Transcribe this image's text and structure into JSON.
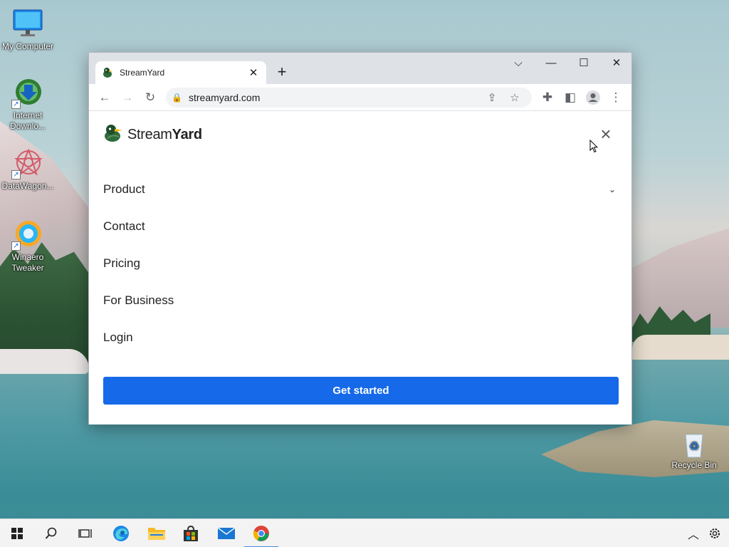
{
  "desktop": {
    "icons": [
      {
        "label": "My Computer",
        "icon": "monitor-icon"
      },
      {
        "label": "Internet Downlo...",
        "icon": "download-manager-icon"
      },
      {
        "label": "DataWagon...",
        "icon": "datawagon-icon"
      },
      {
        "label": "Winaero Tweaker",
        "icon": "winaero-tweaker-icon"
      },
      {
        "label": "Recycle Bin",
        "icon": "recycle-bin-icon"
      }
    ]
  },
  "browser": {
    "tab": {
      "title": "StreamYard",
      "favicon": "streamyard-duck-icon"
    },
    "address": {
      "url": "streamyard.com"
    },
    "window_controls": [
      "chevron-down-icon",
      "minimize-icon",
      "maximize-icon",
      "close-icon"
    ]
  },
  "page": {
    "logo": {
      "word1": "Stream",
      "word2": "Yard"
    },
    "menu": [
      {
        "label": "Product",
        "has_submenu": true
      },
      {
        "label": "Contact"
      },
      {
        "label": "Pricing"
      },
      {
        "label": "For Business"
      },
      {
        "label": "Login"
      }
    ],
    "cta_label": "Get started",
    "cta_color": "#1669e8"
  },
  "taskbar": {
    "apps": [
      "start-icon",
      "search-icon",
      "task-view-icon",
      "edge-icon",
      "file-explorer-icon",
      "store-icon",
      "mail-icon",
      "chrome-icon"
    ],
    "active_app": "chrome-icon",
    "tray": [
      "chevron-up-icon",
      "settings-icon"
    ]
  }
}
